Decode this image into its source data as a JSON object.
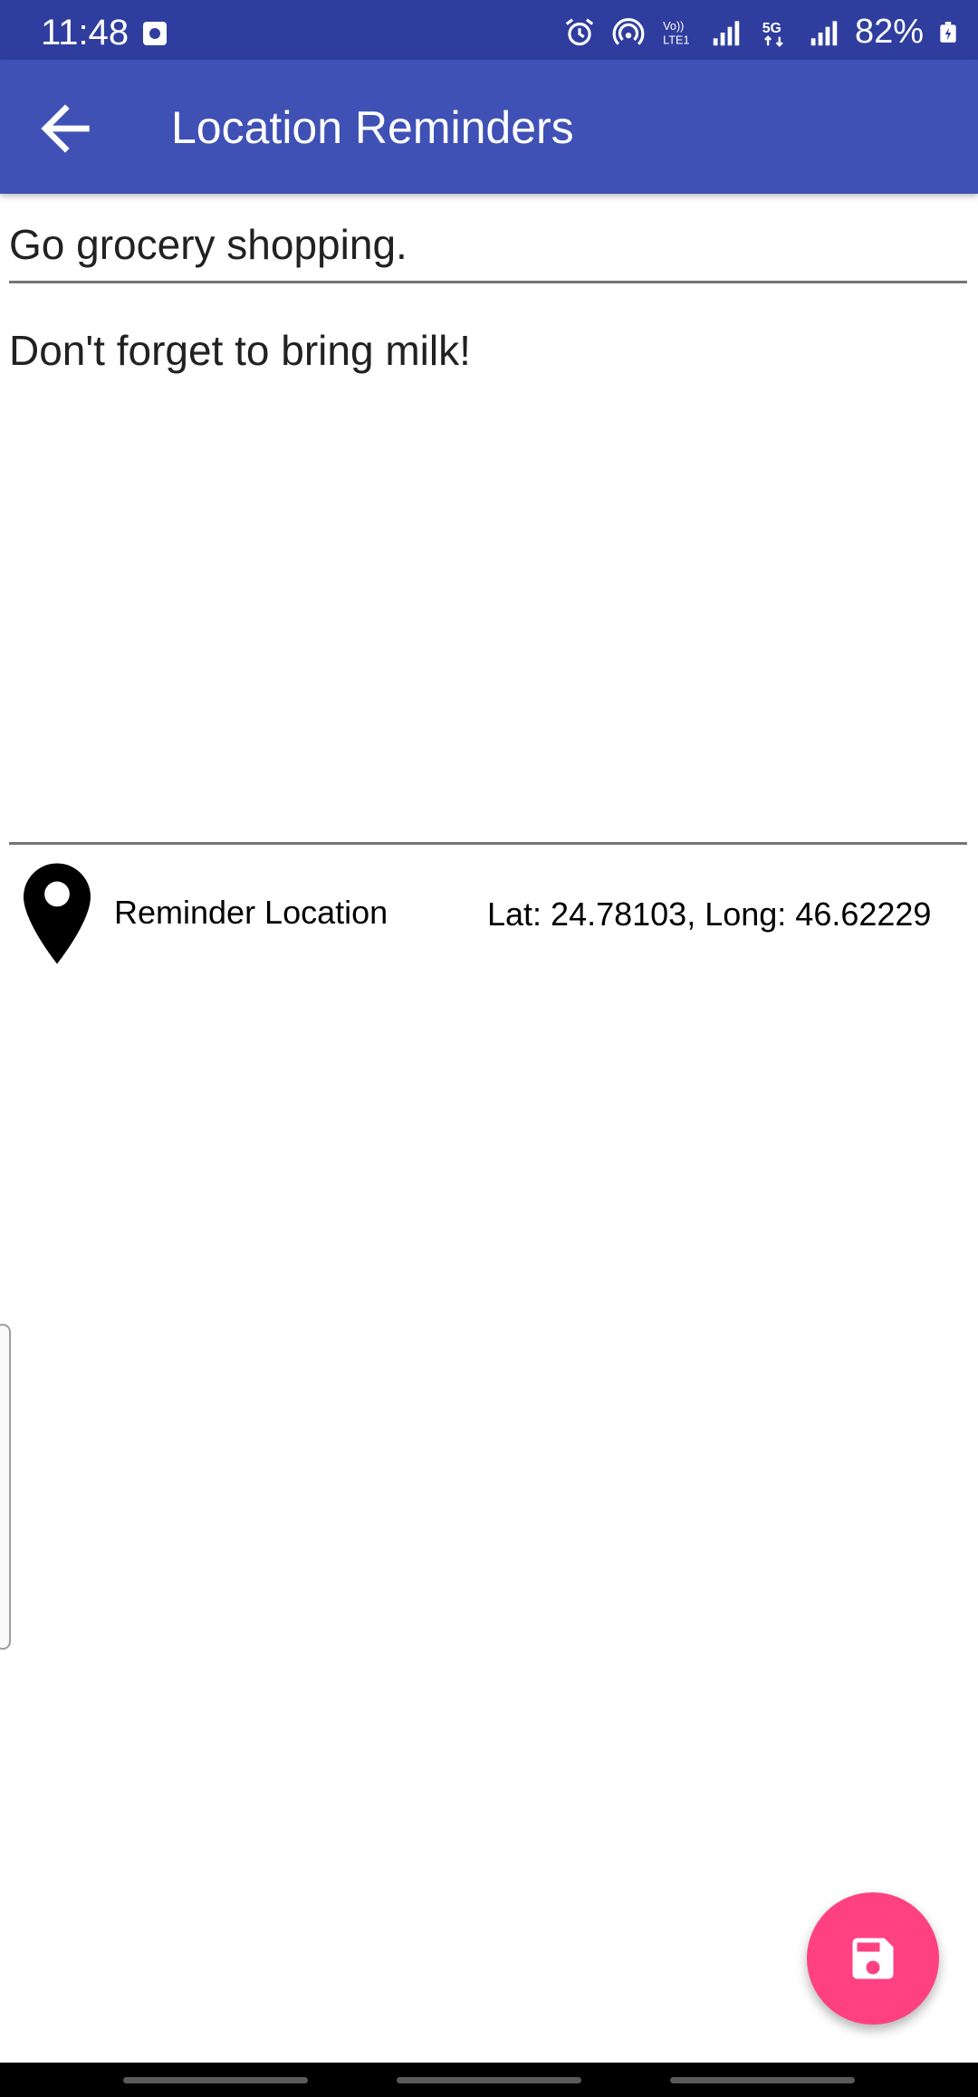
{
  "status_bar": {
    "time": "11:48",
    "battery": "82%",
    "icons": [
      "notification-app-icon",
      "alarm-icon",
      "hotspot-icon",
      "volte-icon",
      "signal-icon",
      "5g-icon",
      "signal-icon",
      "battery-charging-icon"
    ]
  },
  "app_bar": {
    "title": "Location Reminders",
    "back_icon": "arrow-back-icon"
  },
  "form": {
    "title_value": "Go grocery shopping.",
    "description_value": "Don't forget to bring milk!"
  },
  "location": {
    "icon": "map-pin-icon",
    "label": "Reminder Location",
    "coordinates": "Lat: 24.78103, Long: 46.62229"
  },
  "fab": {
    "icon": "save-icon",
    "color": "#ff4081"
  },
  "colors": {
    "status_bar": "#2f3e9e",
    "app_bar": "#3f51b5",
    "accent": "#ff4081"
  }
}
